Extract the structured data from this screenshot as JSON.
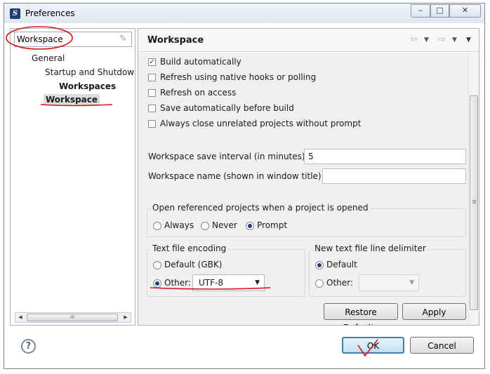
{
  "window": {
    "title": "Preferences",
    "minimize_glyph": "‒",
    "maximize_glyph": "□",
    "close_glyph": "✕"
  },
  "filter": {
    "value": "Workspace",
    "clear_icon": "✎"
  },
  "tree": {
    "general": "General",
    "startup": "Startup and Shutdow",
    "workspaces": "Workspaces",
    "workspace": "Workspace"
  },
  "tree_scroll": {
    "grip": "III"
  },
  "page": {
    "title": "Workspace"
  },
  "nav": {
    "back": "⇦",
    "forward": "⇨",
    "dropdown": "▼"
  },
  "options": [
    {
      "label": "Build automatically",
      "checked": true
    },
    {
      "label": "Refresh using native hooks or polling",
      "checked": false
    },
    {
      "label": "Refresh on access",
      "checked": false
    },
    {
      "label": "Save automatically before build",
      "checked": false
    },
    {
      "label": "Always close unrelated projects without prompt",
      "checked": false
    }
  ],
  "save_interval": {
    "label": "Workspace save interval (in minutes):",
    "value": "5"
  },
  "workspace_name": {
    "label": "Workspace name (shown in window title):",
    "value": ""
  },
  "open_referenced": {
    "title": "Open referenced projects when a project is opened",
    "options": [
      {
        "label": "Always",
        "selected": false
      },
      {
        "label": "Never",
        "selected": false
      },
      {
        "label": "Prompt",
        "selected": true
      }
    ]
  },
  "encoding": {
    "title": "Text file encoding",
    "default_label": "Default (GBK)",
    "default_selected": false,
    "other_label": "Other:",
    "other_selected": true,
    "other_value": "UTF-8"
  },
  "line_delimiter": {
    "title": "New text file line delimiter",
    "default_label": "Default",
    "default_selected": true,
    "other_label": "Other:",
    "other_selected": false,
    "other_value": ""
  },
  "buttons": {
    "restore_defaults": "Restore Defaults",
    "apply": "Apply",
    "ok": "OK",
    "cancel": "Cancel",
    "help": "?"
  },
  "colors": {
    "annotation": "#d7141a",
    "accent": "#3c7fb1"
  }
}
